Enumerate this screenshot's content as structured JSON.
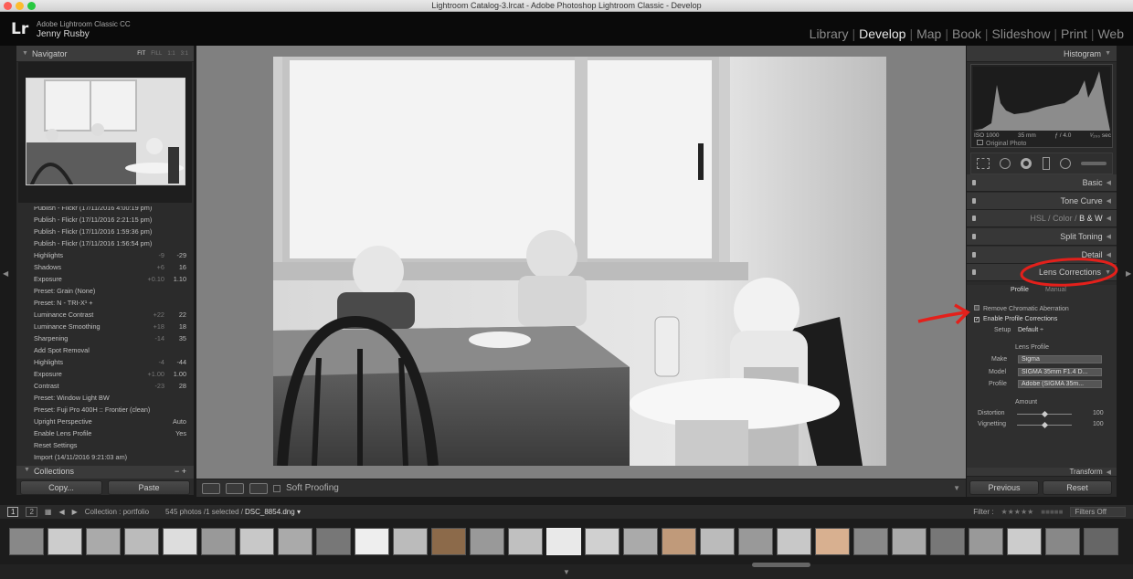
{
  "window": {
    "title": "Lightroom Catalog-3.lrcat - Adobe Photoshop Lightroom Classic - Develop"
  },
  "header": {
    "logo": "Lr",
    "product": "Adobe Lightroom Classic CC",
    "user": "Jenny Rusby",
    "modules": [
      "Library",
      "Develop",
      "Map",
      "Book",
      "Slideshow",
      "Print",
      "Web"
    ]
  },
  "navigator": {
    "title": "Navigator",
    "zoom": [
      "FIT",
      "FILL",
      "1:1",
      "3:1"
    ]
  },
  "history": [
    {
      "label": "Publish - Flickr (17/11/2016 4:00:19 pm)",
      "a": "",
      "b": ""
    },
    {
      "label": "Publish - Flickr (17/11/2016 2:21:15 pm)",
      "a": "",
      "b": ""
    },
    {
      "label": "Publish - Flickr (17/11/2016 1:59:36 pm)",
      "a": "",
      "b": ""
    },
    {
      "label": "Publish - Flickr (17/11/2016 1:56:54 pm)",
      "a": "",
      "b": ""
    },
    {
      "label": "Highlights",
      "a": "-9",
      "b": "-29"
    },
    {
      "label": "Shadows",
      "a": "+6",
      "b": "16"
    },
    {
      "label": "Exposure",
      "a": "+0.10",
      "b": "1.10"
    },
    {
      "label": "Preset: Grain (None)",
      "a": "",
      "b": ""
    },
    {
      "label": "Preset: N - TRI-X¹ +",
      "a": "",
      "b": ""
    },
    {
      "label": "Luminance Contrast",
      "a": "+22",
      "b": "22"
    },
    {
      "label": "Luminance Smoothing",
      "a": "+18",
      "b": "18"
    },
    {
      "label": "Sharpening",
      "a": "-14",
      "b": "35"
    },
    {
      "label": "Add Spot Removal",
      "a": "",
      "b": ""
    },
    {
      "label": "Highlights",
      "a": "-4",
      "b": "-44"
    },
    {
      "label": "Exposure",
      "a": "+1.00",
      "b": "1.00"
    },
    {
      "label": "Contrast",
      "a": "-23",
      "b": "28"
    },
    {
      "label": "Preset: Window Light BW",
      "a": "",
      "b": ""
    },
    {
      "label": "Preset: Fuji Pro 400H :: Frontier (clean)",
      "a": "",
      "b": ""
    },
    {
      "label": "Upright Perspective",
      "a": "",
      "b": "Auto"
    },
    {
      "label": "Enable Lens Profile",
      "a": "",
      "b": "Yes"
    },
    {
      "label": "Reset Settings",
      "a": "",
      "b": ""
    },
    {
      "label": "Import (14/11/2016 9:21:03 am)",
      "a": "",
      "b": ""
    }
  ],
  "collections": {
    "title": "Collections",
    "controls": "−  +"
  },
  "left_buttons": {
    "copy": "Copy...",
    "paste": "Paste"
  },
  "toolbar": {
    "soft_proofing": "Soft Proofing"
  },
  "histogram": {
    "title": "Histogram",
    "iso": "ISO 1000",
    "focal": "35 mm",
    "aperture": "ƒ / 4.0",
    "shutter": "¹⁄₂₀₀ sec",
    "original_photo": "Original Photo"
  },
  "sections": {
    "basic": "Basic",
    "tone_curve": "Tone Curve",
    "hsl": "HSL",
    "color": "Color",
    "bw": "B & W",
    "split_toning": "Split Toning",
    "detail": "Detail",
    "lens_corrections": "Lens Corrections",
    "transform": "Transform"
  },
  "lens": {
    "tab_profile": "Profile",
    "tab_manual": "Manual",
    "remove_ca": "Remove Chromatic Aberration",
    "enable_profile": "Enable Profile Corrections",
    "setup_label": "Setup",
    "setup_value": "Default",
    "lens_profile": "Lens Profile",
    "make_label": "Make",
    "make_value": "Sigma",
    "model_label": "Model",
    "model_value": "SIGMA 35mm F1.4 D...",
    "profile_label": "Profile",
    "profile_value": "Adobe (SIGMA 35m...",
    "amount": "Amount",
    "distortion_label": "Distortion",
    "distortion_value": "100",
    "vignetting_label": "Vignetting",
    "vignetting_value": "100",
    "distortion_level": 0.5,
    "vignetting_level": 0.5
  },
  "right_buttons": {
    "previous": "Previous",
    "reset": "Reset"
  },
  "filmbar": {
    "page1": "1",
    "page2": "2",
    "collection": "Collection : portfolio",
    "count": "545 photos /1 selected /",
    "filename": "DSC_8854.dng",
    "filter_label": "Filter :",
    "filters_off": "Filters Off"
  },
  "colors": {
    "annotation": "#e3201b",
    "panel": "#2b2b2b",
    "accent": "#e8e8e8"
  }
}
